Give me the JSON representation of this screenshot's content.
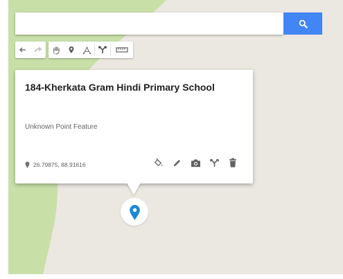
{
  "search": {
    "value": "",
    "placeholder": "",
    "button_icon": "search-icon",
    "button_color": "#4285f4"
  },
  "toolbar": {
    "groups": [
      [
        "undo-icon",
        "redo-icon"
      ],
      [
        "hand-icon",
        "marker-icon",
        "draw-line-icon",
        "directions-icon",
        "ruler-icon"
      ]
    ]
  },
  "popup": {
    "title": "184-Kherkata Gram Hindi Primary School",
    "subtitle": "Unknown Point Feature",
    "coordinates": "26.79875, 88.91616",
    "actions": [
      "paint-bucket-icon",
      "edit-icon",
      "camera-icon",
      "directions-icon",
      "delete-icon"
    ]
  },
  "map": {
    "land_color": "#ebe8e1",
    "park_color": "#c8dfa8",
    "marker_color": "#1e88d6"
  }
}
